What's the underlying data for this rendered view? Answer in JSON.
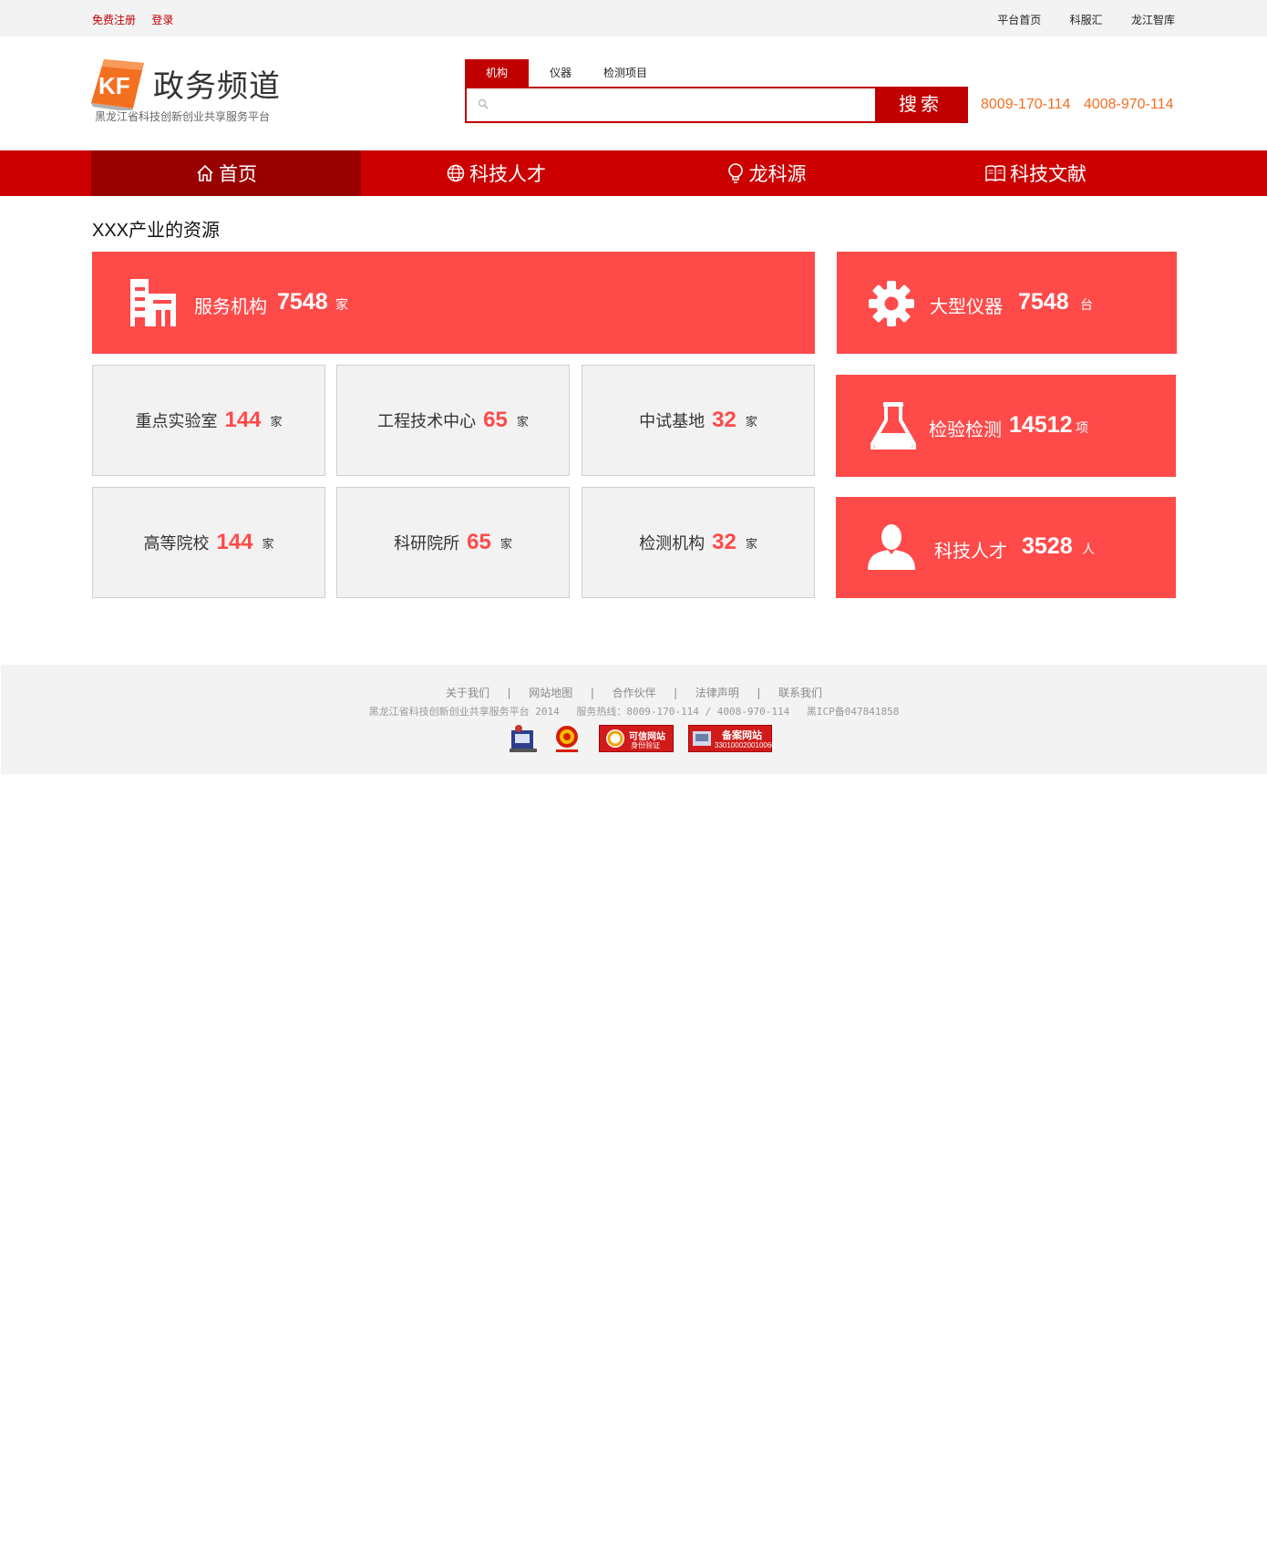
{
  "topbar": {
    "register": "免费注册",
    "login": "登录",
    "links": [
      "平台首页",
      "科服汇",
      "龙江智库"
    ]
  },
  "header": {
    "logo_mark": "KF",
    "logo_title": "政务频道",
    "logo_subtitle": "黑龙江省科技创新创业共享服务平台",
    "search": {
      "tabs": [
        "机构",
        "仪器",
        "检测项目"
      ],
      "active_tab": "机构",
      "placeholder": "",
      "button": "搜索"
    },
    "hotlines": [
      "8009-170-114",
      "4008-970-114"
    ]
  },
  "nav": {
    "items": [
      {
        "label": "首页",
        "icon": "home-icon",
        "active": true
      },
      {
        "label": "科技人才",
        "icon": "globe-icon",
        "active": false
      },
      {
        "label": "龙科源",
        "icon": "bulb-icon",
        "active": false
      },
      {
        "label": "科技文献",
        "icon": "book-icon",
        "active": false
      }
    ]
  },
  "section_title": "XXX产业的资源",
  "main_tile": {
    "label": "服务机构",
    "value": "7548",
    "unit": "家",
    "icon": "building-icon"
  },
  "sub_tiles": [
    {
      "label": "重点实验室",
      "value": "144",
      "unit": "家"
    },
    {
      "label": "工程技术中心",
      "value": "65",
      "unit": "家"
    },
    {
      "label": "中试基地",
      "value": "32",
      "unit": "家"
    },
    {
      "label": "高等院校",
      "value": "144",
      "unit": "家"
    },
    {
      "label": "科研院所",
      "value": "65",
      "unit": "家"
    },
    {
      "label": "检测机构",
      "value": "32",
      "unit": "家"
    }
  ],
  "side_tiles": [
    {
      "label": "大型仪器",
      "value": "7548",
      "unit": "台",
      "icon": "gear-icon"
    },
    {
      "label": "检验检测",
      "value": "14512",
      "unit": "项",
      "icon": "flask-icon"
    },
    {
      "label": "科技人才",
      "value": "3528",
      "unit": "人",
      "icon": "person-icon"
    }
  ],
  "footer": {
    "links": [
      "关于我们",
      "网站地图",
      "合作伙伴",
      "法律声明",
      "联系我们"
    ],
    "separator": "|",
    "copyright": "黑龙江省科技创新创业共享服务平台 2014",
    "service_hotline": "服务热线：8009-170-114 / 4008-970-114",
    "icp": "黑ICP备047841858",
    "badges": {
      "trusted_title": "可信网站",
      "trusted_sub": "身份验证",
      "record_title": "备案网站",
      "record_number": "330100020010060"
    }
  },
  "colors": {
    "brand_red": "#cc0000",
    "nav_active": "#990000",
    "tile_red": "#ff4a4a",
    "hotline_orange": "#f26f21",
    "logo_orange": "#f37021"
  }
}
